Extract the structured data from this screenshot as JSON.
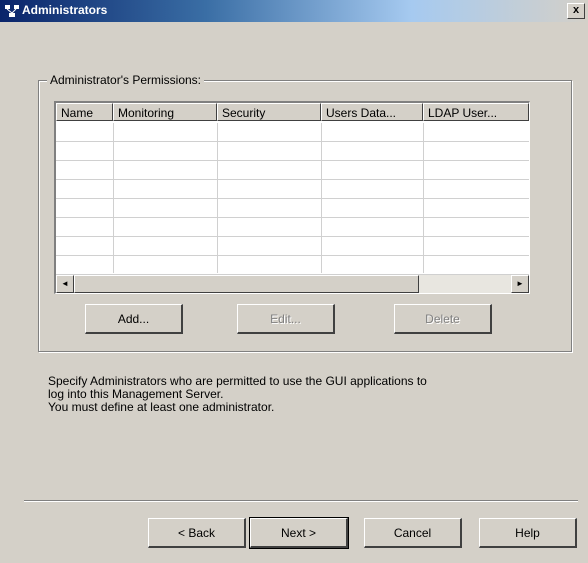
{
  "window": {
    "title": "Administrators",
    "close_glyph": "x"
  },
  "permissions_group": {
    "label": "Administrator's Permissions:",
    "columns": [
      "Name",
      "Monitoring",
      "Security",
      "Users Data...",
      "LDAP User..."
    ],
    "rows": [],
    "scroll_left": "◄",
    "scroll_right": "►",
    "buttons": {
      "add": "Add...",
      "edit": "Edit...",
      "delete": "Delete"
    }
  },
  "description": {
    "line1": "Specify Administrators who are permitted to use the GUI applications to",
    "line2": "log into this Management Server.",
    "line3": "You must define at least one administrator."
  },
  "footer": {
    "back": "< Back",
    "next": "Next >",
    "cancel": "Cancel",
    "help": "Help"
  }
}
